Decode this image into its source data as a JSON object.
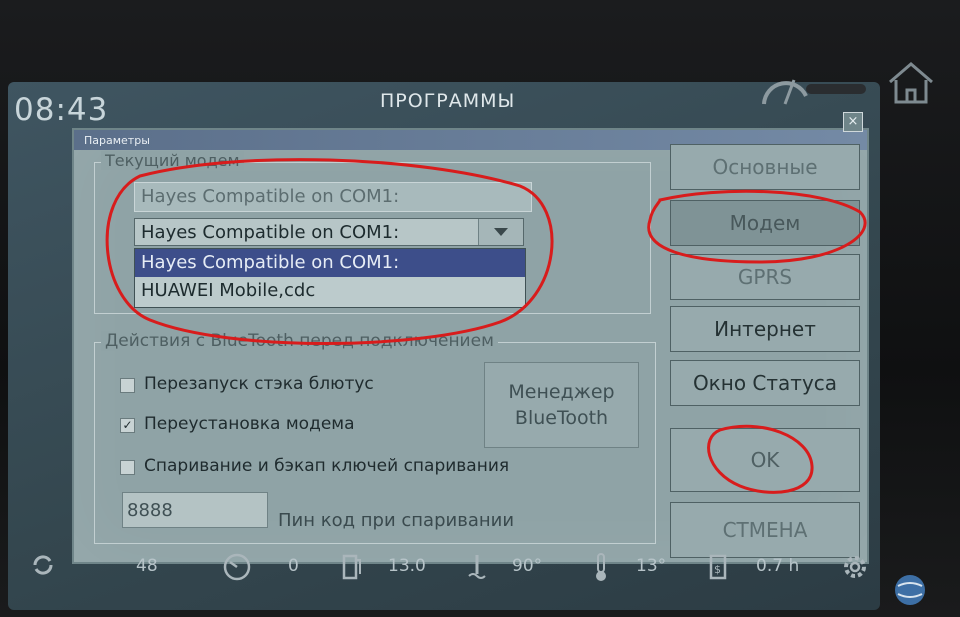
{
  "header": {
    "clock": "08:43",
    "title": "ПРОГРАММЫ"
  },
  "dialog": {
    "title": "Параметры",
    "close_label": "×",
    "modem_group": {
      "legend": "Текущий модем",
      "readonly_value": "Hayes Compatible on COM1:",
      "combo_value": "Hayes Compatible on COM1:",
      "options": [
        "Hayes Compatible on COM1:",
        "HUAWEI Mobile,cdc"
      ]
    },
    "bluetooth_group": {
      "legend": "Действия с BlueTooth перед подключением",
      "checks": [
        {
          "label": "Перезапуск стэка блютус",
          "checked": false
        },
        {
          "label": "Переустановка модема",
          "checked": true
        },
        {
          "label": "Спаривание и бэкап ключей спаривания",
          "checked": false
        }
      ],
      "manager_label_1": "Менеджер",
      "manager_label_2": "BlueTooth",
      "pin_value": "8888",
      "pin_label": "Пин код при спаривании"
    },
    "side_buttons": {
      "main": "Основные",
      "modem": "Модем",
      "gprs": "GPRS",
      "internet": "Интернет",
      "status": "Окно Статуса",
      "ok": "OK",
      "cancel": "СТМЕНА"
    }
  },
  "status_bar": {
    "speed": "48",
    "gauge_value": "0",
    "fuel_value": "13.0",
    "coolant_value": "90°",
    "outside_temp": "13°",
    "trip_time": "0.7 h"
  },
  "colors": {
    "screen": "#3f5561",
    "dialog": "#8fa3a6",
    "selection": "#3d4e8a",
    "annotation": "#d81c1c"
  }
}
